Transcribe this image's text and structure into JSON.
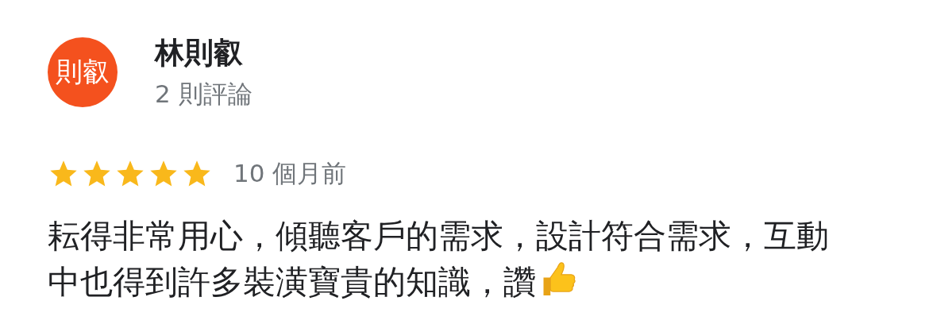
{
  "reviewer": {
    "avatar_text": "則叡",
    "name": "林則叡",
    "review_count": "2 則評論"
  },
  "review": {
    "stars": 5,
    "time": "10 個月前",
    "text": "耘得非常用心，傾聽客戶的需求，設計符合需求，互動中也得到許多裝潢寶貴的知識，讚"
  }
}
